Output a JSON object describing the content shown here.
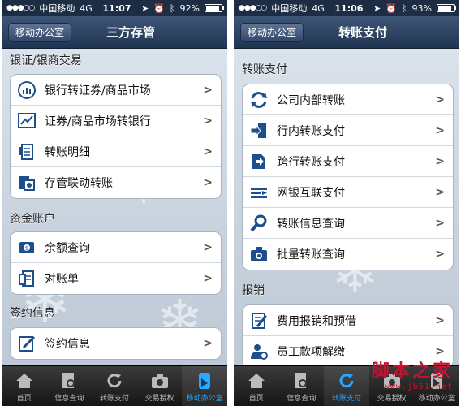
{
  "left": {
    "status": {
      "signal": "●●●○○",
      "carrier": "中国移动",
      "network": "4G",
      "time": "11:07",
      "battery": "92%"
    },
    "nav": {
      "back_label": "移动办公室",
      "title": "三方存管"
    },
    "sections": [
      {
        "title": "银证/银商交易",
        "items": [
          {
            "label": "银行转证券/商品市场",
            "icon": "bank-transfer-icon"
          },
          {
            "label": "证券/商品市场转银行",
            "icon": "chart-transfer-icon"
          },
          {
            "label": "转账明细",
            "icon": "document-icon"
          },
          {
            "label": "存管联动转账",
            "icon": "linked-transfer-icon"
          }
        ]
      },
      {
        "title": "资金账户",
        "items": [
          {
            "label": "余额查询",
            "icon": "balance-icon"
          },
          {
            "label": "对账单",
            "icon": "statement-icon"
          }
        ]
      },
      {
        "title": "签约信息",
        "items": [
          {
            "label": "签约信息",
            "icon": "sign-icon"
          }
        ]
      }
    ],
    "tabs": [
      {
        "label": "首页",
        "icon": "home-icon"
      },
      {
        "label": "信息查询",
        "icon": "info-query-icon"
      },
      {
        "label": "转账支付",
        "icon": "refresh-icon"
      },
      {
        "label": "交易授权",
        "icon": "camera-icon"
      },
      {
        "label": "移动办公室",
        "icon": "mobile-office-icon"
      }
    ],
    "active_tab": 4
  },
  "right": {
    "status": {
      "signal": "●●●○○",
      "carrier": "中国移动",
      "network": "4G",
      "time": "11:06",
      "battery": "93%"
    },
    "nav": {
      "back_label": "移动办公室",
      "title": "转账支付"
    },
    "sections": [
      {
        "title": "转账支付",
        "items": [
          {
            "label": "公司内部转账",
            "icon": "cycle-arrows-icon"
          },
          {
            "label": "行内转账支付",
            "icon": "enter-icon"
          },
          {
            "label": "跨行转账支付",
            "icon": "interbank-icon"
          },
          {
            "label": "网银互联支付",
            "icon": "interconnect-icon"
          },
          {
            "label": "转账信息查询",
            "icon": "magnifier-icon"
          },
          {
            "label": "批量转账查询",
            "icon": "batch-camera-icon"
          }
        ]
      },
      {
        "title": "报销",
        "items": [
          {
            "label": "费用报销和预借",
            "icon": "expense-icon"
          },
          {
            "label": "员工款项解缴",
            "icon": "employee-icon"
          }
        ]
      }
    ],
    "tabs": [
      {
        "label": "首页",
        "icon": "home-icon"
      },
      {
        "label": "信息查询",
        "icon": "info-query-icon"
      },
      {
        "label": "转账支付",
        "icon": "refresh-icon"
      },
      {
        "label": "交易授权",
        "icon": "camera-icon"
      },
      {
        "label": "移动办公室",
        "icon": "mobile-office-icon"
      }
    ],
    "active_tab": 2
  },
  "watermark": {
    "main": "脚本之家",
    "sub": "www.jb51.net"
  },
  "colors": {
    "nav_bar": "#203552",
    "tab_active": "#2aa7ff",
    "icon_blue": "#1d4f8c",
    "tabbar": "#151515"
  }
}
